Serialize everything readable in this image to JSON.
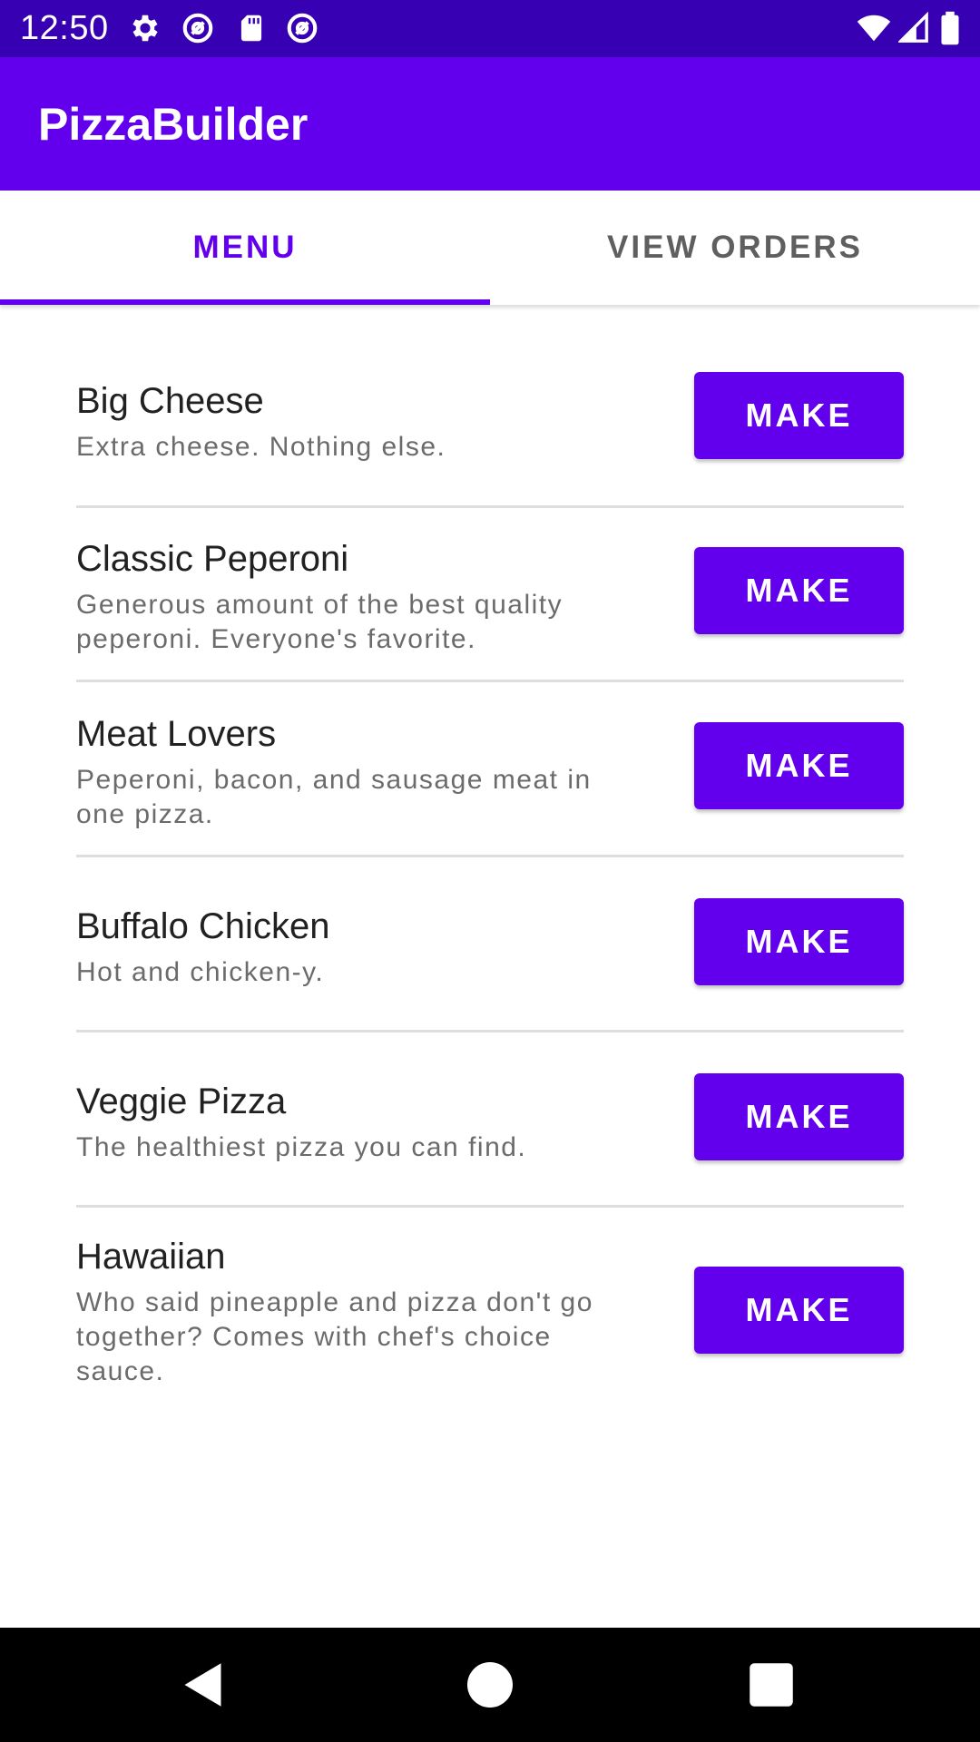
{
  "status_bar": {
    "time": "12:50",
    "left_icons": [
      "gear-icon",
      "at-sign-icon",
      "sd-card-icon",
      "at-sign-icon"
    ],
    "right_icons": [
      "wifi-icon",
      "signal-icon",
      "battery-icon"
    ],
    "background": "#3700B3"
  },
  "app_bar": {
    "title": "PizzaBuilder",
    "background": "#6200EE"
  },
  "tabs": [
    {
      "label": "MENU",
      "selected": true
    },
    {
      "label": "VIEW ORDERS",
      "selected": false
    }
  ],
  "menu": {
    "items": [
      {
        "name": "Big Cheese",
        "description": "Extra cheese. Nothing else.",
        "button_label": "MAKE"
      },
      {
        "name": "Classic Peperoni",
        "description": "Generous amount of the best quality peperoni. Everyone's favorite.",
        "button_label": "MAKE"
      },
      {
        "name": "Meat Lovers",
        "description": "Peperoni, bacon, and sausage meat in one pizza.",
        "button_label": "MAKE"
      },
      {
        "name": "Buffalo Chicken",
        "description": "Hot and chicken-y.",
        "button_label": "MAKE"
      },
      {
        "name": "Veggie Pizza",
        "description": "The healthiest pizza you can find.",
        "button_label": "MAKE"
      },
      {
        "name": "Hawaiian",
        "description": "Who said pineapple and pizza don't go together? Comes with chef's choice sauce.",
        "button_label": "MAKE"
      }
    ]
  },
  "nav_bar": {
    "buttons": [
      "back-icon",
      "home-icon",
      "recents-icon"
    ]
  },
  "colors": {
    "primary": "#6200EE",
    "primary_dark": "#3700B3",
    "text_primary": "#212121",
    "text_secondary": "#6b6b6b"
  }
}
